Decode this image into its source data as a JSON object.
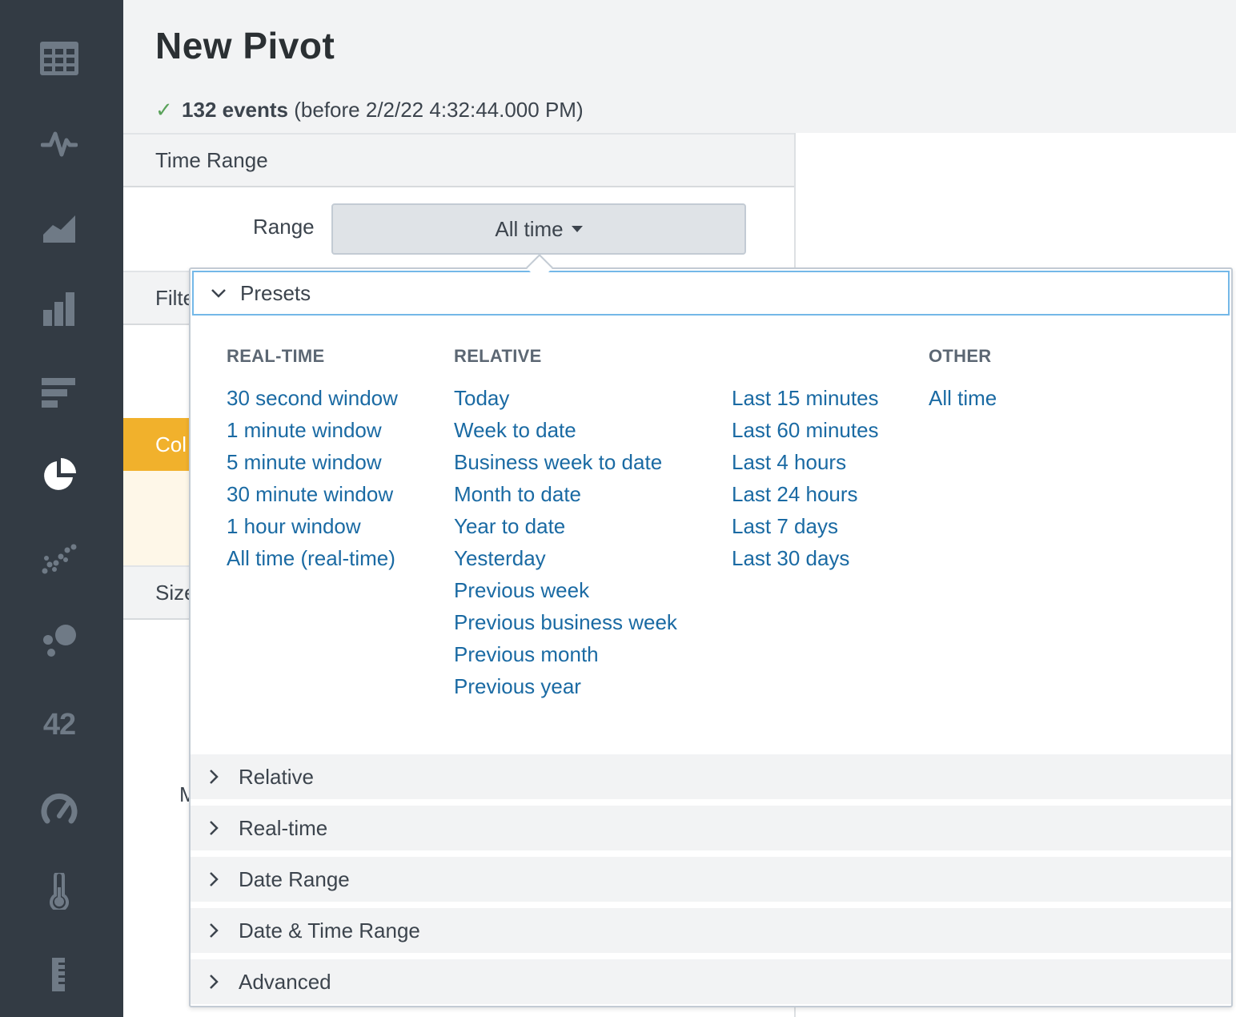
{
  "page": {
    "title": "New Pivot",
    "status_check": "✓",
    "events_count": "132 events",
    "events_before": "(before 2/2/22 4:32:44.000 PM)"
  },
  "sidebar": {
    "icons": [
      "table-icon",
      "pulse-icon",
      "area-chart-icon",
      "column-chart-icon",
      "bar-chart-icon",
      "pie-chart-icon",
      "scatter-icon",
      "bubble-icon",
      "single-value-icon",
      "radial-gauge-icon",
      "filler-gauge-icon",
      "marker-gauge-icon"
    ],
    "single_value_text": "42"
  },
  "panel": {
    "time_range_header": "Time Range",
    "range_label": "Range",
    "range_value": "All time",
    "filter_header_partial": "Filte",
    "color_header_partial": "Col",
    "size_header_partial": "Size",
    "stray_letter": "M"
  },
  "dropdown": {
    "presets_label": "Presets",
    "columns": {
      "realtime": {
        "heading": "REAL-TIME",
        "items": [
          "30 second window",
          "1 minute window",
          "5 minute window",
          "30 minute window",
          "1 hour window",
          "All time (real-time)"
        ]
      },
      "relative": {
        "heading": "RELATIVE",
        "items": [
          "Today",
          "Week to date",
          "Business week to date",
          "Month to date",
          "Year to date",
          "Yesterday",
          "Previous week",
          "Previous business week",
          "Previous month",
          "Previous year"
        ]
      },
      "relative2": {
        "items": [
          "Last 15 minutes",
          "Last 60 minutes",
          "Last 4 hours",
          "Last 24 hours",
          "Last 7 days",
          "Last 30 days"
        ]
      },
      "other": {
        "heading": "OTHER",
        "items": [
          "All time"
        ]
      }
    },
    "sections": [
      "Relative",
      "Real-time",
      "Date Range",
      "Date & Time Range",
      "Advanced"
    ]
  }
}
